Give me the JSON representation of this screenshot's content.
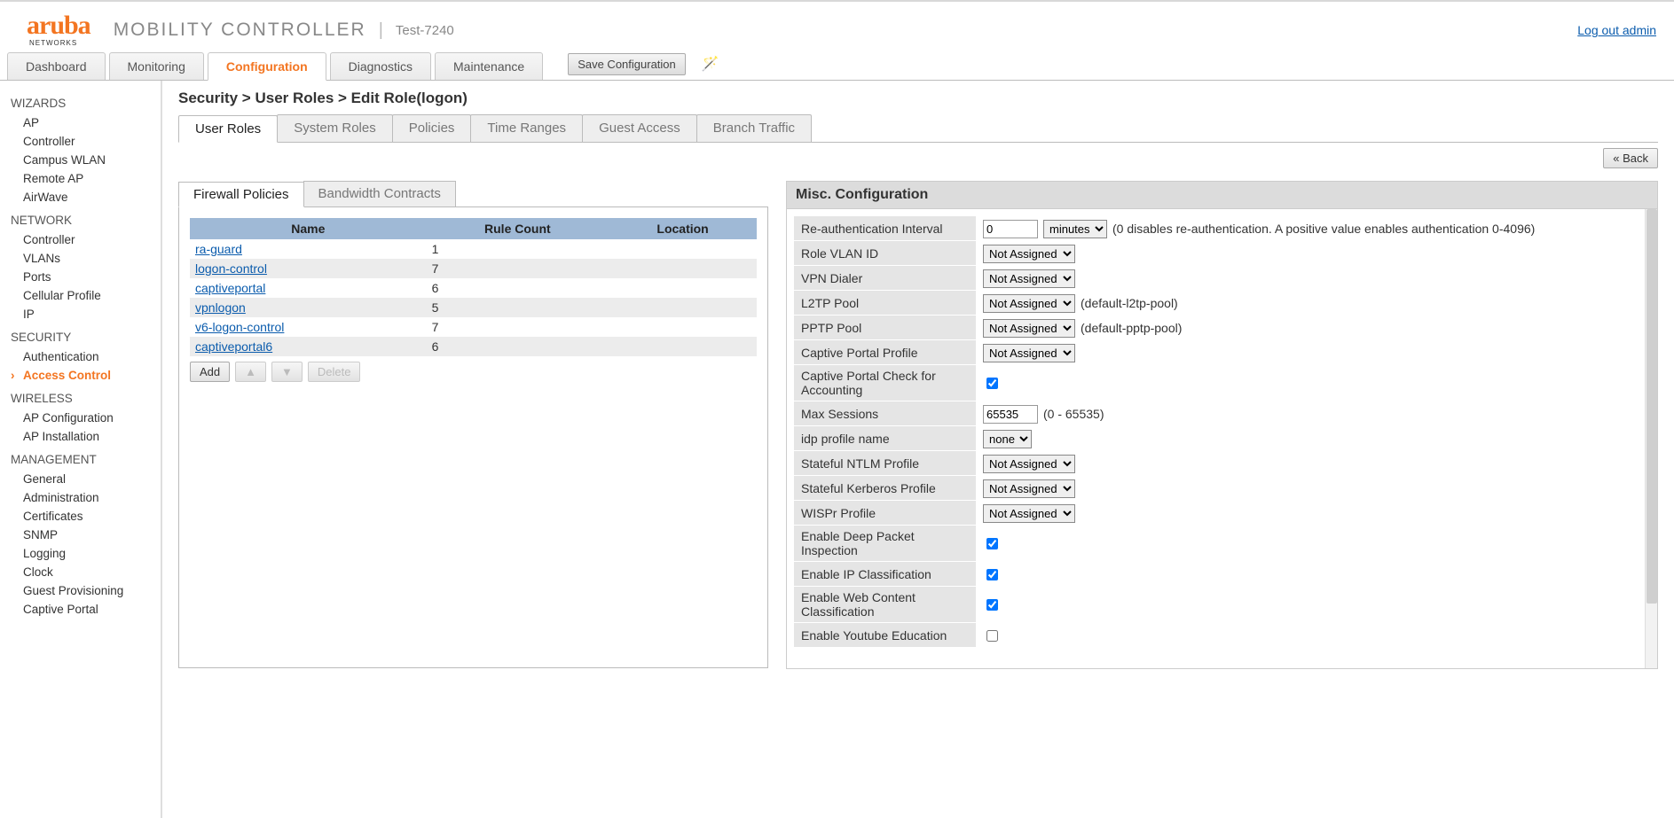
{
  "header": {
    "brand": "aruba",
    "brand_sub": "NETWORKS",
    "product": "MOBILITY CONTROLLER",
    "hostname": "Test-7240",
    "logout": "Log out admin"
  },
  "primary_tabs": [
    "Dashboard",
    "Monitoring",
    "Configuration",
    "Diagnostics",
    "Maintenance"
  ],
  "primary_active": 2,
  "save_btn": "Save Configuration",
  "sidebar": [
    {
      "head": "WIZARDS",
      "items": [
        "AP",
        "Controller",
        "Campus WLAN",
        "Remote AP",
        "AirWave"
      ]
    },
    {
      "head": "NETWORK",
      "items": [
        "Controller",
        "VLANs",
        "Ports",
        "Cellular Profile",
        "IP"
      ]
    },
    {
      "head": "SECURITY",
      "items": [
        "Authentication",
        "Access Control"
      ],
      "active_index": 1
    },
    {
      "head": "WIRELESS",
      "items": [
        "AP Configuration",
        "AP Installation"
      ]
    },
    {
      "head": "MANAGEMENT",
      "items": [
        "General",
        "Administration",
        "Certificates",
        "SNMP",
        "Logging",
        "Clock",
        "Guest Provisioning",
        "Captive Portal"
      ]
    }
  ],
  "breadcrumb": "Security > User Roles > Edit Role(logon)",
  "sec_tabs": [
    "User Roles",
    "System Roles",
    "Policies",
    "Time Ranges",
    "Guest Access",
    "Branch Traffic"
  ],
  "sec_active": 0,
  "back_btn": "« Back",
  "inner_tabs": [
    "Firewall Policies",
    "Bandwidth Contracts"
  ],
  "inner_active": 0,
  "pol_table": {
    "headers": [
      "Name",
      "Rule Count",
      "Location"
    ],
    "rows": [
      {
        "name": "ra-guard",
        "count": "1",
        "location": ""
      },
      {
        "name": "logon-control",
        "count": "7",
        "location": ""
      },
      {
        "name": "captiveportal",
        "count": "6",
        "location": ""
      },
      {
        "name": "vpnlogon",
        "count": "5",
        "location": ""
      },
      {
        "name": "v6-logon-control",
        "count": "7",
        "location": ""
      },
      {
        "name": "captiveportal6",
        "count": "6",
        "location": ""
      }
    ]
  },
  "tbl_buttons": {
    "add": "Add",
    "up": "▲",
    "down": "▼",
    "delete": "Delete"
  },
  "misc_title": "Misc. Configuration",
  "misc": [
    {
      "label": "Re-authentication Interval",
      "type": "text+select",
      "value": "0",
      "options": [
        "minutes"
      ],
      "hint": "(0 disables re-authentication. A positive value enables authentication 0-4096)"
    },
    {
      "label": "Role VLAN ID",
      "type": "select",
      "options": [
        "Not Assigned"
      ]
    },
    {
      "label": "VPN Dialer",
      "type": "select",
      "options": [
        "Not Assigned"
      ]
    },
    {
      "label": "L2TP Pool",
      "type": "select",
      "options": [
        "Not Assigned"
      ],
      "hint": "(default-l2tp-pool)"
    },
    {
      "label": "PPTP Pool",
      "type": "select",
      "options": [
        "Not Assigned"
      ],
      "hint": "(default-pptp-pool)"
    },
    {
      "label": "Captive Portal Profile",
      "type": "select",
      "options": [
        "Not Assigned"
      ]
    },
    {
      "label": "Captive Portal Check for Accounting",
      "type": "checkbox",
      "checked": true
    },
    {
      "label": "Max Sessions",
      "type": "text",
      "value": "65535",
      "hint": "(0 - 65535)"
    },
    {
      "label": "idp profile name",
      "type": "select",
      "options": [
        "none"
      ]
    },
    {
      "label": "Stateful NTLM Profile",
      "type": "select",
      "options": [
        "Not Assigned"
      ]
    },
    {
      "label": "Stateful Kerberos Profile",
      "type": "select",
      "options": [
        "Not Assigned"
      ]
    },
    {
      "label": "WISPr Profile",
      "type": "select",
      "options": [
        "Not Assigned"
      ]
    },
    {
      "label": "Enable Deep Packet Inspection",
      "type": "checkbox",
      "checked": true
    },
    {
      "label": "Enable IP Classification",
      "type": "checkbox",
      "checked": true
    },
    {
      "label": "Enable Web Content Classification",
      "type": "checkbox",
      "checked": true
    },
    {
      "label": "Enable Youtube Education",
      "type": "checkbox",
      "checked": false
    }
  ]
}
